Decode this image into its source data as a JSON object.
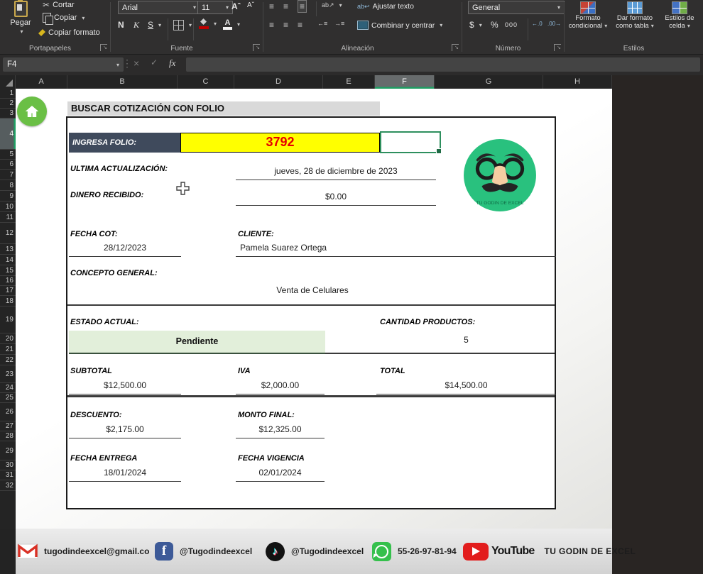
{
  "ribbon": {
    "clipboard": {
      "paste": "Pegar",
      "cut": "Cortar",
      "copy": "Copiar",
      "format_painter": "Copiar formato",
      "group": "Portapapeles"
    },
    "font": {
      "family": "Arial",
      "size": "11",
      "bold": "N",
      "italic": "K",
      "underline": "S",
      "group": "Fuente"
    },
    "alignment": {
      "wrap": "Ajustar texto",
      "merge": "Combinar y centrar",
      "group": "Alineación"
    },
    "number": {
      "format": "General",
      "currency": "$",
      "percent": "%",
      "thousands": "000",
      "group": "Número"
    },
    "styles": {
      "conditional": "Formato condicional",
      "table": "Dar formato como tabla",
      "cell": "Estilos de celda",
      "group": "Estilos"
    }
  },
  "formula_bar": {
    "name_box": "F4",
    "fx": "fx",
    "formula": ""
  },
  "grid": {
    "columns": [
      "A",
      "B",
      "C",
      "D",
      "E",
      "F",
      "G",
      "H"
    ],
    "selected_column": "F",
    "rows": [
      "1",
      "2",
      "3",
      "4",
      "5",
      "6",
      "7",
      "8",
      "9",
      "10",
      "11",
      "12",
      "13",
      "14",
      "15",
      "16",
      "17",
      "18",
      "19",
      "20",
      "21",
      "22",
      "23",
      "24",
      "25",
      "26",
      "27",
      "28",
      "29",
      "30",
      "31",
      "32"
    ],
    "selected_row": "4"
  },
  "form": {
    "title": "BUSCAR COTIZACIÓN CON FOLIO",
    "folio_label": "INGRESA FOLIO:",
    "folio_value": "3792",
    "last_update_label": "ULTIMA ACTUALIZACIÓN:",
    "last_update_value": "jueves, 28 de diciembre de 2023",
    "money_received_label": "DINERO RECIBIDO:",
    "money_received_value": "$0.00",
    "quote_date_label": "FECHA COT:",
    "quote_date_value": "28/12/2023",
    "client_label": "CLIENTE:",
    "client_value": "Pamela Suarez Ortega",
    "concept_label": "CONCEPTO GENERAL:",
    "concept_value": "Venta de Celulares",
    "status_label": "ESTADO ACTUAL:",
    "status_value": "Pendiente",
    "quantity_label": "CANTIDAD PRODUCTOS:",
    "quantity_value": "5",
    "subtotal_label": "SUBTOTAL",
    "subtotal_value": "$12,500.00",
    "iva_label": "IVA",
    "iva_value": "$2,000.00",
    "total_label": "TOTAL",
    "total_value": "$14,500.00",
    "discount_label": "DESCUENTO:",
    "discount_value": "$2,175.00",
    "final_amount_label": "MONTO FINAL:",
    "final_amount_value": "$12,325.00",
    "delivery_date_label": "FECHA ENTREGA",
    "delivery_date_value": "18/01/2024",
    "validity_date_label": "FECHA VIGENCIA",
    "validity_date_value": "02/01/2024",
    "avatar_caption": "TU GODIN DE EXCEL"
  },
  "footer": {
    "email": "tugodindeexcel@gmail.co",
    "facebook_handle": "@Tugodindeexcel",
    "tiktok_handle": "@Tugodindeexcel",
    "whatsapp_number": "55-26-97-81-94",
    "youtube_label": "YouTube",
    "brand": "TU GODIN DE EXCEL"
  },
  "colors": {
    "accent_green": "#1f9e63",
    "folio_bg": "#ffff00",
    "folio_text": "#e60000",
    "label_cell_bg": "#3f4a5c",
    "status_bg": "#e2efda",
    "avatar_green": "#29c17e"
  }
}
